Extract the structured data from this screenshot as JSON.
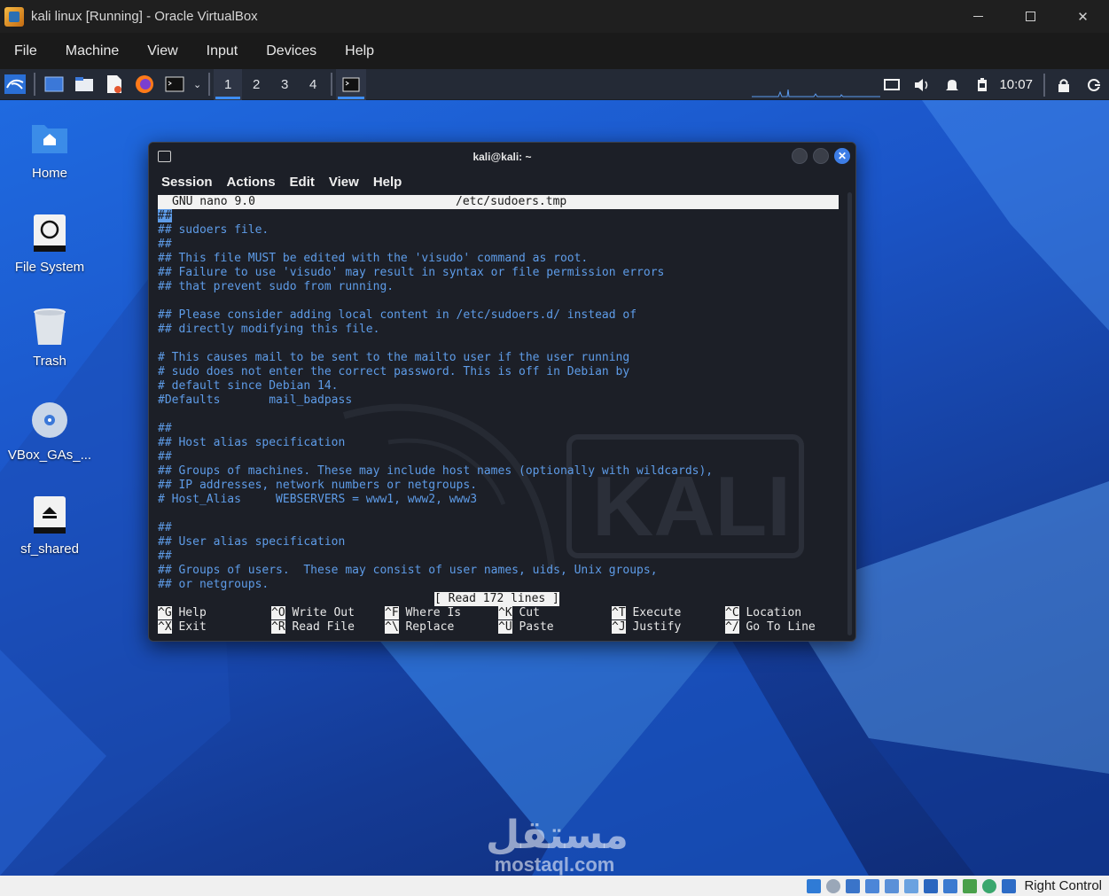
{
  "host_window": {
    "title": "kali linux [Running] - Oracle VirtualBox",
    "menu": [
      "File",
      "Machine",
      "View",
      "Input",
      "Devices",
      "Help"
    ],
    "controls": [
      "minimize",
      "maximize",
      "close"
    ]
  },
  "kali_panel": {
    "launchers": [
      "kali-menu-icon",
      "show-desktop-icon",
      "file-manager-icon",
      "text-editor-icon",
      "firefox-icon",
      "terminal-icon"
    ],
    "workspaces": [
      "1",
      "2",
      "3",
      "4"
    ],
    "active_workspace": "1",
    "clock": "10:07"
  },
  "desktop_icons": [
    "Home",
    "File System",
    "Trash",
    "VBox_GAs_...",
    "sf_shared"
  ],
  "watermark": {
    "arabic": "مستقل",
    "latin": "mostaql.com"
  },
  "terminal": {
    "title": "kali@kali: ~",
    "menu": [
      "Session",
      "Actions",
      "Edit",
      "View",
      "Help"
    ],
    "nano_version": "GNU nano 9.0",
    "file": "/etc/sudoers.tmp",
    "lines": [
      "##",
      "## sudoers file.",
      "##",
      "## This file MUST be edited with the 'visudo' command as root.",
      "## Failure to use 'visudo' may result in syntax or file permission errors",
      "## that prevent sudo from running.",
      "",
      "## Please consider adding local content in /etc/sudoers.d/ instead of",
      "## directly modifying this file.",
      "",
      "# This causes mail to be sent to the mailto user if the user running",
      "# sudo does not enter the correct password. This is off in Debian by",
      "# default since Debian 14.",
      "#Defaults       mail_badpass",
      "",
      "##",
      "## Host alias specification",
      "##",
      "## Groups of machines. These may include host names (optionally with wildcards),",
      "## IP addresses, network numbers or netgroups.",
      "# Host_Alias     WEBSERVERS = www1, www2, www3",
      "",
      "##",
      "## User alias specification",
      "##",
      "## Groups of users.  These may consist of user names, uids, Unix groups,",
      "## or netgroups."
    ],
    "status_message": "[ Read 172 lines ]",
    "shortcuts_row1": [
      {
        "key": "^G",
        "label": "Help"
      },
      {
        "key": "^O",
        "label": "Write Out"
      },
      {
        "key": "^F",
        "label": "Where Is"
      },
      {
        "key": "^K",
        "label": "Cut"
      },
      {
        "key": "^T",
        "label": "Execute"
      },
      {
        "key": "^C",
        "label": "Location"
      }
    ],
    "shortcuts_row2": [
      {
        "key": "^X",
        "label": "Exit"
      },
      {
        "key": "^R",
        "label": "Read File"
      },
      {
        "key": "^\\",
        "label": "Replace"
      },
      {
        "key": "^U",
        "label": "Paste"
      },
      {
        "key": "^J",
        "label": "Justify"
      },
      {
        "key": "^/",
        "label": "Go To Line"
      }
    ]
  },
  "vb_statusbar": {
    "host_key": "Right Control"
  },
  "colors": {
    "nano_comment": "#5e9ce8",
    "desktop_blue": "#1f6ae0",
    "active_accent": "#3d8df5"
  }
}
